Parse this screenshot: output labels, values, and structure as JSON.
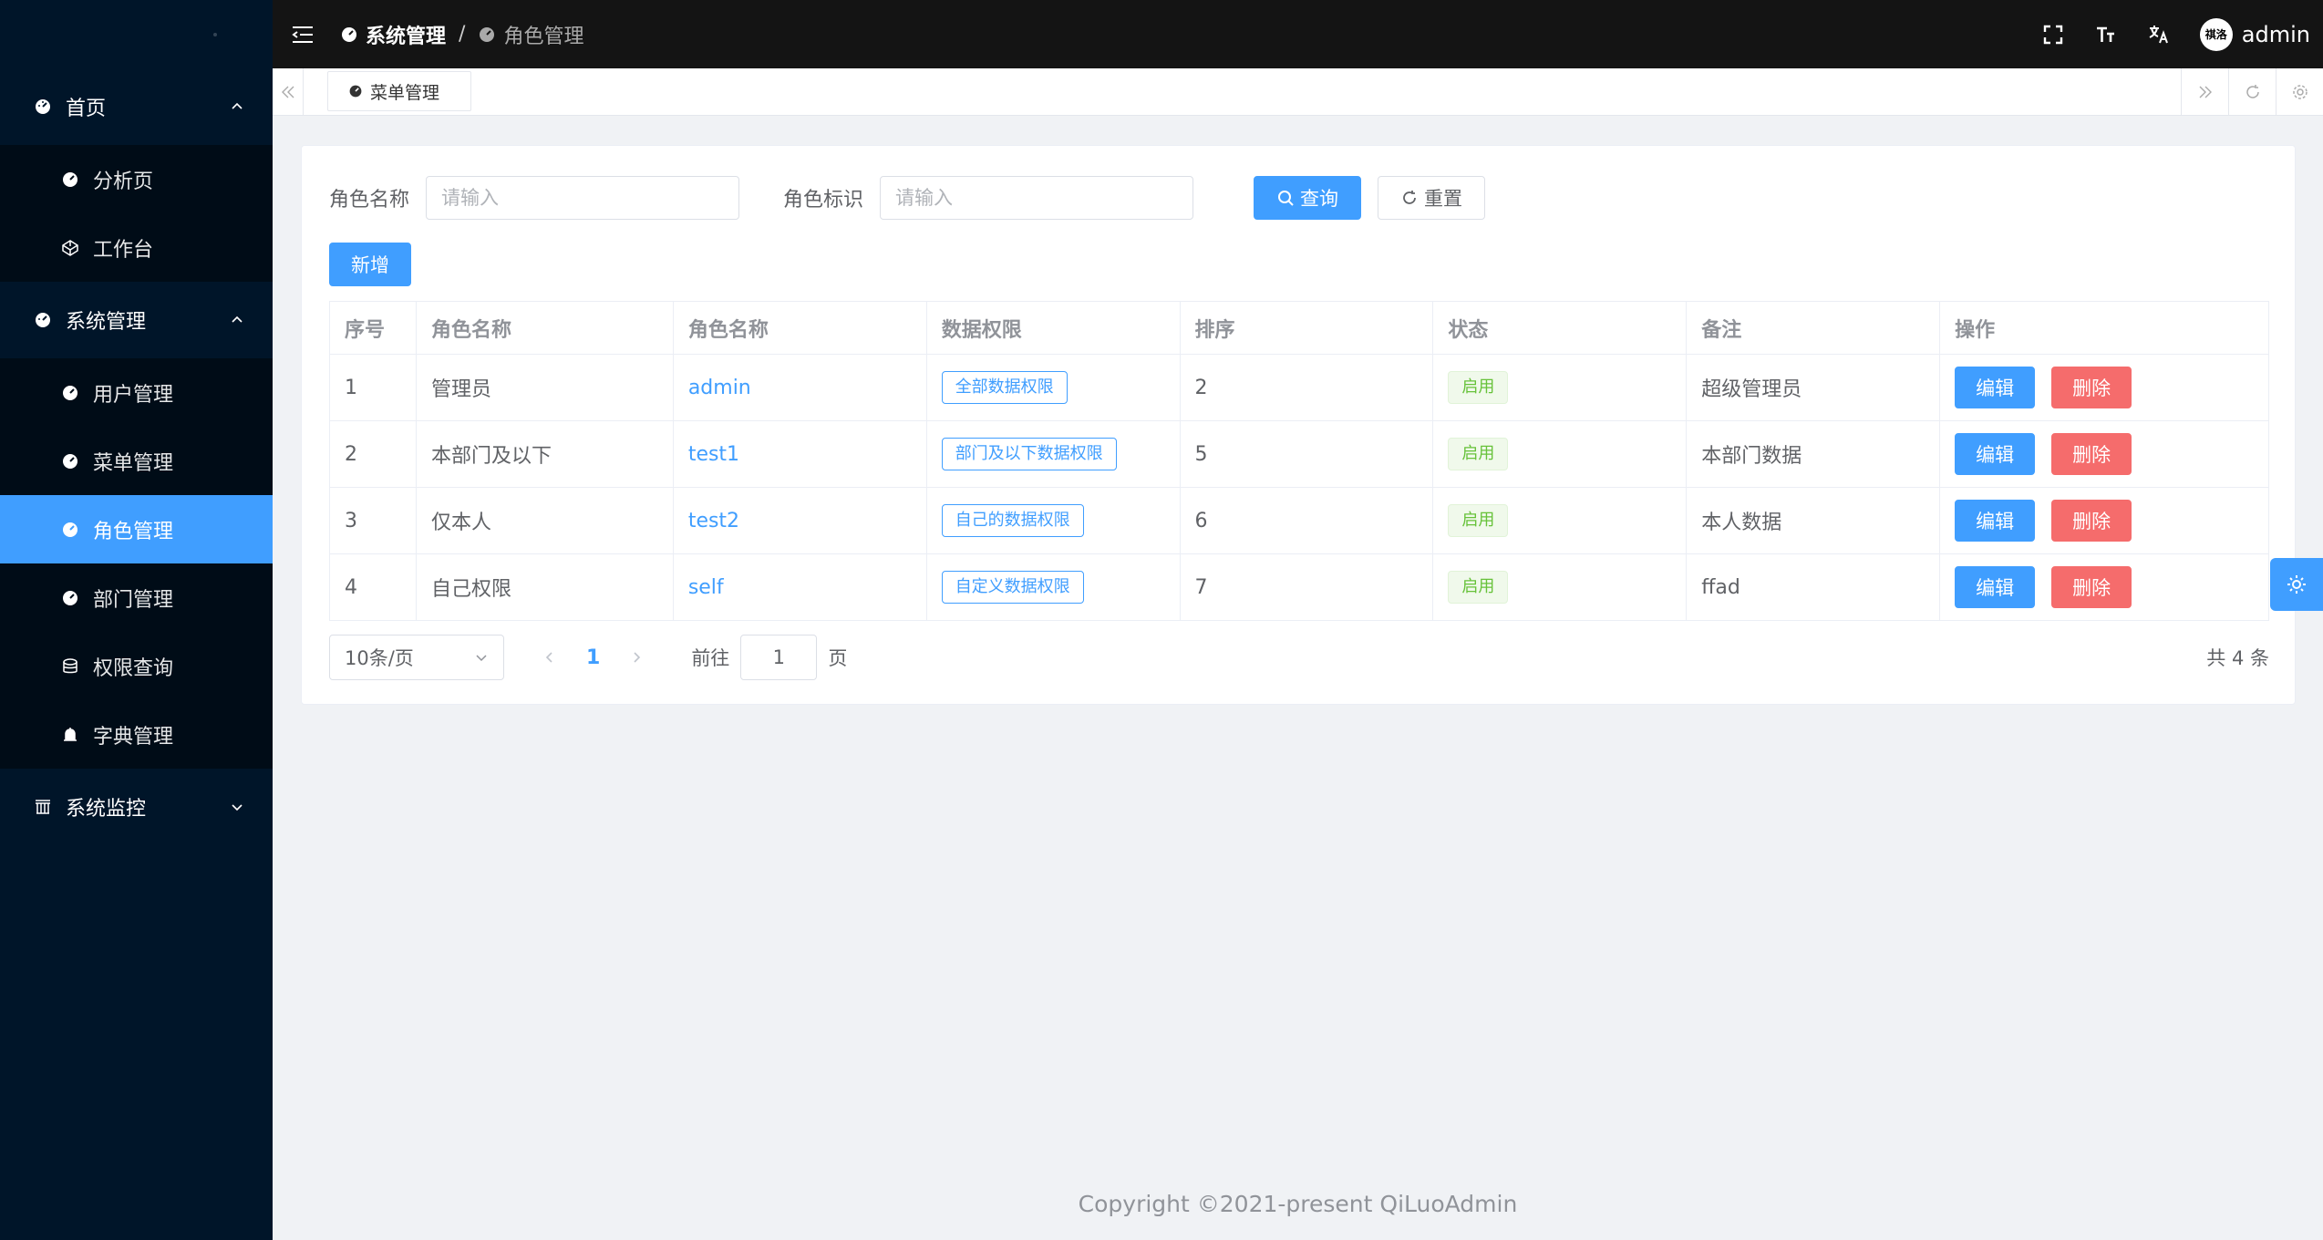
{
  "sidebar": {
    "items": [
      {
        "label": "首页",
        "icon": "dashboard-icon",
        "expanded": true,
        "children": [
          {
            "label": "分析页",
            "icon": "dashboard-icon"
          },
          {
            "label": "工作台",
            "icon": "codepen-icon"
          }
        ]
      },
      {
        "label": "系统管理",
        "icon": "dashboard-icon",
        "expanded": true,
        "children": [
          {
            "label": "用户管理",
            "icon": "dashboard-icon"
          },
          {
            "label": "菜单管理",
            "icon": "dashboard-icon"
          },
          {
            "label": "角色管理",
            "icon": "dashboard-icon",
            "active": true
          },
          {
            "label": "部门管理",
            "icon": "dashboard-icon"
          },
          {
            "label": "权限查询",
            "icon": "database-icon"
          },
          {
            "label": "字典管理",
            "icon": "bell-icon"
          }
        ]
      },
      {
        "label": "系统监控",
        "icon": "bank-icon",
        "expanded": false
      }
    ]
  },
  "header": {
    "breadcrumb": [
      "系统管理",
      "/",
      "角色管理"
    ],
    "username": "admin",
    "avatar_text": "祺洛"
  },
  "tabs": {
    "active_tab": "菜单管理"
  },
  "search": {
    "role_name_label": "角色名称",
    "role_name_placeholder": "请输入",
    "role_key_label": "角色标识",
    "role_key_placeholder": "请输入",
    "query_label": "查询",
    "reset_label": "重置"
  },
  "toolbar": {
    "add_label": "新增"
  },
  "table": {
    "columns": [
      "序号",
      "角色名称",
      "角色名称",
      "数据权限",
      "排序",
      "状态",
      "备注",
      "操作"
    ],
    "rows": [
      {
        "no": "1",
        "name": "管理员",
        "key": "admin",
        "scope": "全部数据权限",
        "sort": "2",
        "status": "启用",
        "remark": "超级管理员"
      },
      {
        "no": "2",
        "name": "本部门及以下",
        "key": "test1",
        "scope": "部门及以下数据权限",
        "sort": "5",
        "status": "启用",
        "remark": "本部门数据"
      },
      {
        "no": "3",
        "name": "仅本人",
        "key": "test2",
        "scope": "自己的数据权限",
        "sort": "6",
        "status": "启用",
        "remark": "本人数据"
      },
      {
        "no": "4",
        "name": "自己权限",
        "key": "self",
        "scope": "自定义数据权限",
        "sort": "7",
        "status": "启用",
        "remark": "ffad"
      }
    ],
    "edit_label": "编辑",
    "delete_label": "删除"
  },
  "pagination": {
    "page_size": "10条/页",
    "current_page": "1",
    "goto_label": "前往",
    "goto_value": "1",
    "page_unit": "页",
    "total": "共 4 条"
  },
  "footer": {
    "copyright": "Copyright ©2021-present QiLuoAdmin"
  },
  "colors": {
    "primary": "#409eff",
    "danger": "#f56c6c",
    "success": "#67c23a",
    "sidebar_bg": "#001529",
    "header_bg": "#141414"
  }
}
